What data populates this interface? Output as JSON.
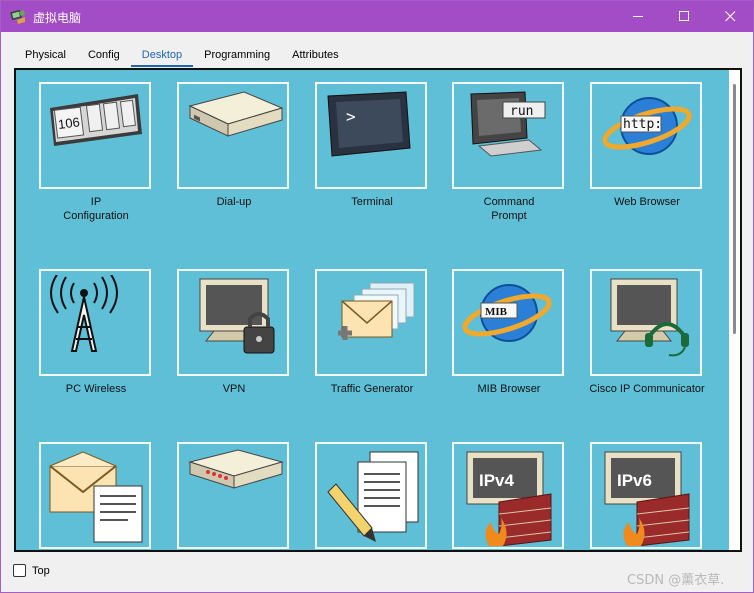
{
  "window": {
    "title": "虚拟电脑"
  },
  "tabs": [
    "Physical",
    "Config",
    "Desktop",
    "Programming",
    "Attributes"
  ],
  "active_tab": "Desktop",
  "apps": {
    "ip_config": {
      "label": "IP\nConfiguration",
      "icon_text": "106"
    },
    "dialup": {
      "label": "Dial-up"
    },
    "terminal": {
      "label": "Terminal",
      "icon_text": ">"
    },
    "cmd": {
      "label": "Command\nPrompt",
      "icon_text": "run"
    },
    "web": {
      "label": "Web Browser",
      "icon_text": "http:"
    },
    "wireless": {
      "label": "PC Wireless"
    },
    "vpn": {
      "label": "VPN"
    },
    "traffic": {
      "label": "Traffic Generator"
    },
    "mib": {
      "label": "MIB Browser",
      "icon_text": "MIB"
    },
    "cisco_ip": {
      "label": "Cisco IP Communicator"
    },
    "email": {
      "label": ""
    },
    "pppoe": {
      "label": ""
    },
    "editor": {
      "label": ""
    },
    "ipv4fw": {
      "label": "",
      "icon_text": "IPv4"
    },
    "ipv6fw": {
      "label": "",
      "icon_text": "IPv6"
    }
  },
  "footer": {
    "top_label": "Top",
    "top_checked": false
  },
  "watermark": "CSDN @薰衣草."
}
